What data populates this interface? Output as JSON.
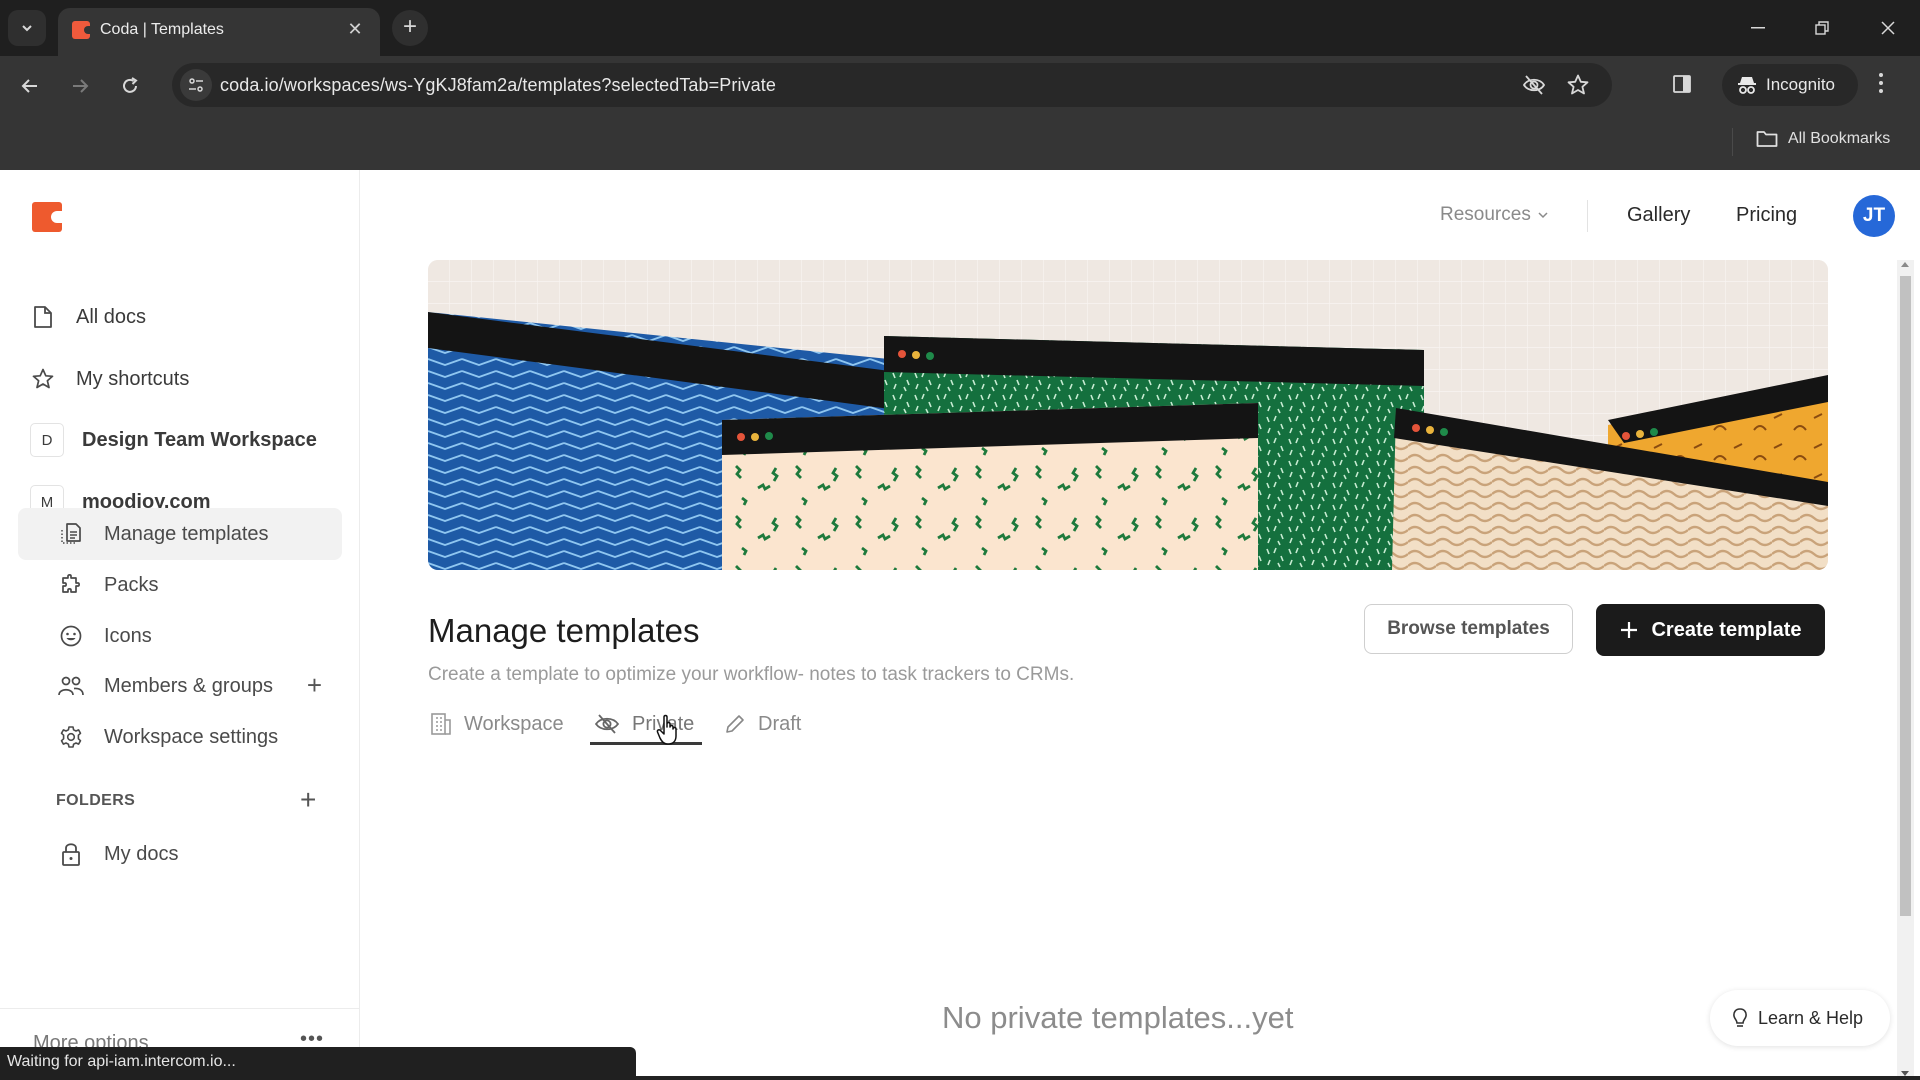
{
  "browser": {
    "tab_title": "Coda | Templates",
    "url": "coda.io/workspaces/ws-YgKJ8fam2a/templates?selectedTab=Private",
    "incognito_label": "Incognito",
    "all_bookmarks_label": "All Bookmarks",
    "status_text": "Waiting for api-iam.intercom.io..."
  },
  "brand": {
    "accent": "#ee5a2e",
    "avatar_color": "#2668d8"
  },
  "header": {
    "resources_label": "Resources",
    "gallery_label": "Gallery",
    "pricing_label": "Pricing",
    "avatar_initials": "JT"
  },
  "sidebar": {
    "top_items": [
      {
        "label": "All docs",
        "icon": "document-icon"
      },
      {
        "label": "My shortcuts",
        "icon": "star-icon"
      }
    ],
    "workspaces": [
      {
        "badge": "D",
        "label": "Design Team Workspace"
      },
      {
        "badge": "M",
        "label": "moodjoy.com"
      }
    ],
    "workspace_items": [
      {
        "label": "Manage templates",
        "icon": "template-icon",
        "active": true
      },
      {
        "label": "Packs",
        "icon": "puzzle-icon"
      },
      {
        "label": "Icons",
        "icon": "smiley-icon"
      },
      {
        "label": "Members & groups",
        "icon": "people-icon"
      },
      {
        "label": "Workspace settings",
        "icon": "gear-icon"
      }
    ],
    "folders_label": "FOLDERS",
    "folders": [
      {
        "label": "My docs",
        "icon": "lock-icon"
      }
    ],
    "more_options_label": "More options"
  },
  "main": {
    "title": "Manage templates",
    "subtitle": "Create a template to optimize your workflow- notes to task trackers to CRMs.",
    "browse_button": "Browse templates",
    "create_button": "Create template",
    "tabs": [
      {
        "label": "Workspace",
        "icon": "building-icon"
      },
      {
        "label": "Private",
        "icon": "eye-off-icon",
        "active": true
      },
      {
        "label": "Draft",
        "icon": "pencil-icon"
      }
    ],
    "empty_state": "No private templates...yet",
    "learn_help_label": "Learn & Help"
  }
}
